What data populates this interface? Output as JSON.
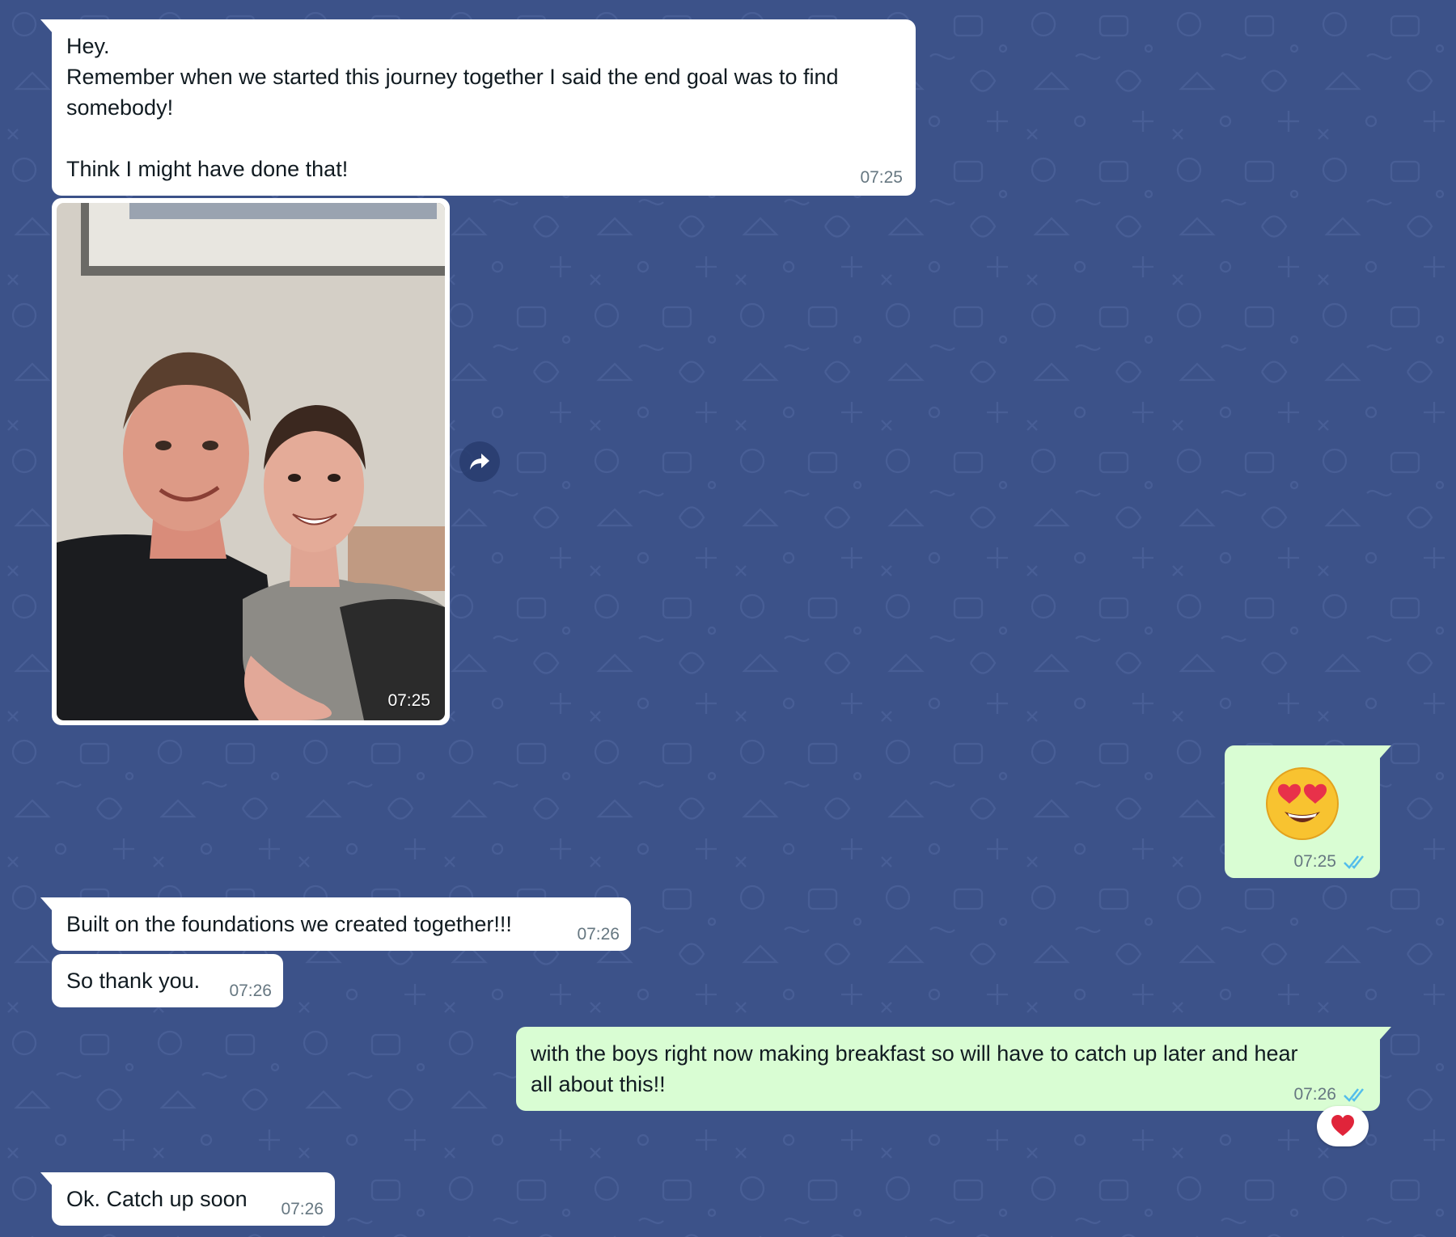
{
  "colors": {
    "wallpaper": "#3c5289",
    "incoming_bubble": "#ffffff",
    "outgoing_bubble": "#d9fdd3",
    "timestamp": "#667781",
    "read_ticks": "#53bdeb"
  },
  "messages": {
    "m1": {
      "direction": "incoming",
      "text": "Hey.\nRemember when we started this journey together I said the end goal was to find somebody!\n\nThink I might have done that!",
      "time": "07:25"
    },
    "m2": {
      "direction": "incoming",
      "type": "photo",
      "time": "07:25"
    },
    "m3": {
      "direction": "outgoing",
      "emoji": "smiling-face-with-heart-eyes",
      "time": "07:25",
      "status": "read-double-tick"
    },
    "m4": {
      "direction": "incoming",
      "text": "Built on the foundations we created together!!!",
      "time": "07:26"
    },
    "m5": {
      "direction": "incoming",
      "text": "So thank you.",
      "time": "07:26"
    },
    "m6": {
      "direction": "outgoing",
      "text": "with the boys right now making breakfast so will have to catch up later and hear all about this!!",
      "time": "07:26",
      "status": "read-double-tick",
      "reaction": "red-heart"
    },
    "m7": {
      "direction": "incoming",
      "text": "Ok. Catch up soon",
      "time": "07:26"
    }
  },
  "icons": {
    "forward": "forward-arrow-icon",
    "reaction": "heart-icon",
    "read_status": "double-check-icon"
  }
}
